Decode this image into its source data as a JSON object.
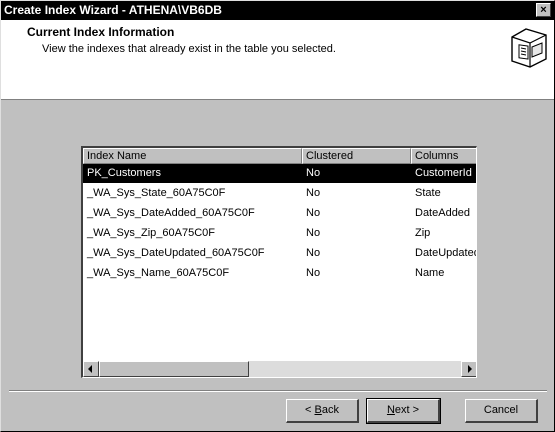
{
  "window": {
    "title": "Create Index Wizard - ATHENA\\VB6DB",
    "close_label": "×"
  },
  "header": {
    "title": "Current Index Information",
    "subtitle": "View the indexes that already exist in the table you selected.",
    "icon": "wizard-document-icon"
  },
  "list": {
    "columns": [
      "Index Name",
      "Clustered",
      "Columns"
    ],
    "rows": [
      [
        "PK_Customers",
        "No",
        "CustomerId"
      ],
      [
        "_WA_Sys_State_60A75C0F",
        "No",
        "State"
      ],
      [
        "_WA_Sys_DateAdded_60A75C0F",
        "No",
        "DateAdded"
      ],
      [
        "_WA_Sys_Zip_60A75C0F",
        "No",
        "Zip"
      ],
      [
        "_WA_Sys_DateUpdated_60A75C0F",
        "No",
        "DateUpdated"
      ],
      [
        "_WA_Sys_Name_60A75C0F",
        "No",
        "Name"
      ]
    ],
    "selected_row": 0
  },
  "buttons": {
    "back_prefix": "< ",
    "back_key": "B",
    "back_rest": "ack",
    "next_key": "N",
    "next_rest": "ext >",
    "cancel": "Cancel"
  },
  "colors": {
    "titlebar": "#000000",
    "face": "#c0c0c0",
    "selection": "#000000"
  }
}
